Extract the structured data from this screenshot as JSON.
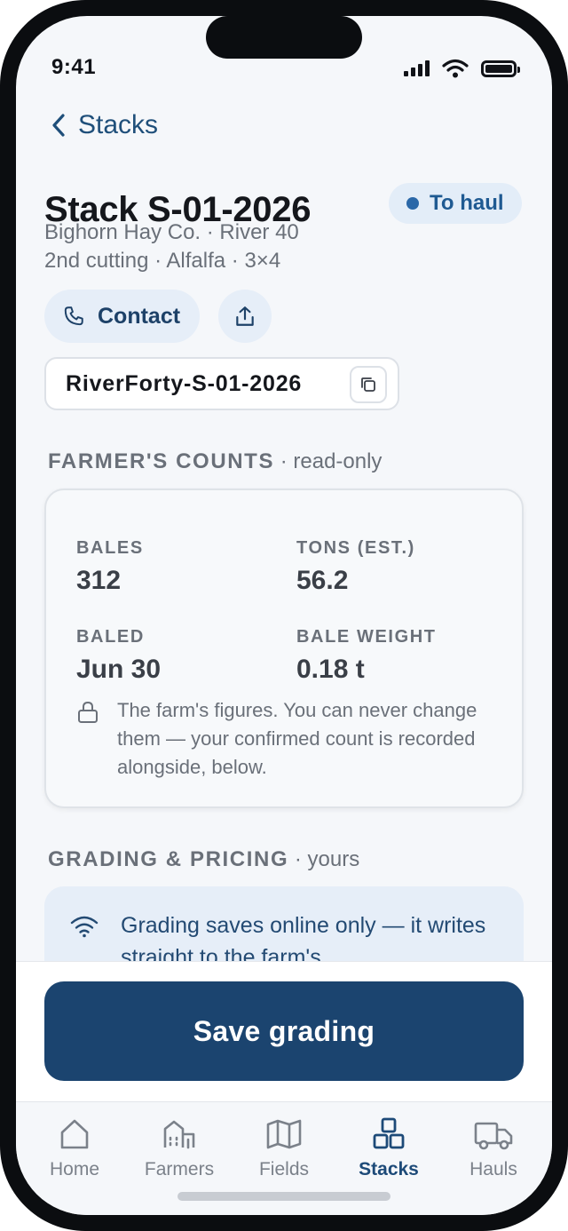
{
  "status": {
    "time": "9:41"
  },
  "nav": {
    "back_label": "Stacks"
  },
  "stack": {
    "title": "Stack S-01-2026",
    "status_badge": "To haul",
    "subtitle_line1": "Bighorn Hay Co. · River 40",
    "subtitle_line2": "2nd cutting · Alfalfa · 3×4",
    "contact_label": "Contact",
    "code": "RiverForty-S-01-2026"
  },
  "farmer_counts": {
    "section_title": "FARMER'S COUNTS",
    "section_suffix": " · read-only",
    "bales_label": "BALES",
    "bales_value": "312",
    "tons_label": "TONS (EST.)",
    "tons_value": "56.2",
    "baled_label": "BALED",
    "baled_value": "Jun 30",
    "bale_weight_label": "BALE WEIGHT",
    "bale_weight_value": "0.18 t",
    "note": "The farm's figures. You can never change them — your confirmed count is recorded alongside, below."
  },
  "grading": {
    "section_title": "GRADING & PRICING",
    "section_suffix": " · yours",
    "online_note": "Grading saves online only — it writes straight to the farm's",
    "save_label": "Save grading"
  },
  "tabs": [
    {
      "label": "Home",
      "icon": "home-icon"
    },
    {
      "label": "Farmers",
      "icon": "farm-building-icon"
    },
    {
      "label": "Fields",
      "icon": "map-icon"
    },
    {
      "label": "Stacks",
      "icon": "stack-icon",
      "active": true
    },
    {
      "label": "Hauls",
      "icon": "truck-icon"
    }
  ],
  "colors": {
    "accent": "#1b446f",
    "badge_bg": "#e3edf8",
    "badge_dot": "#2b68a8"
  }
}
